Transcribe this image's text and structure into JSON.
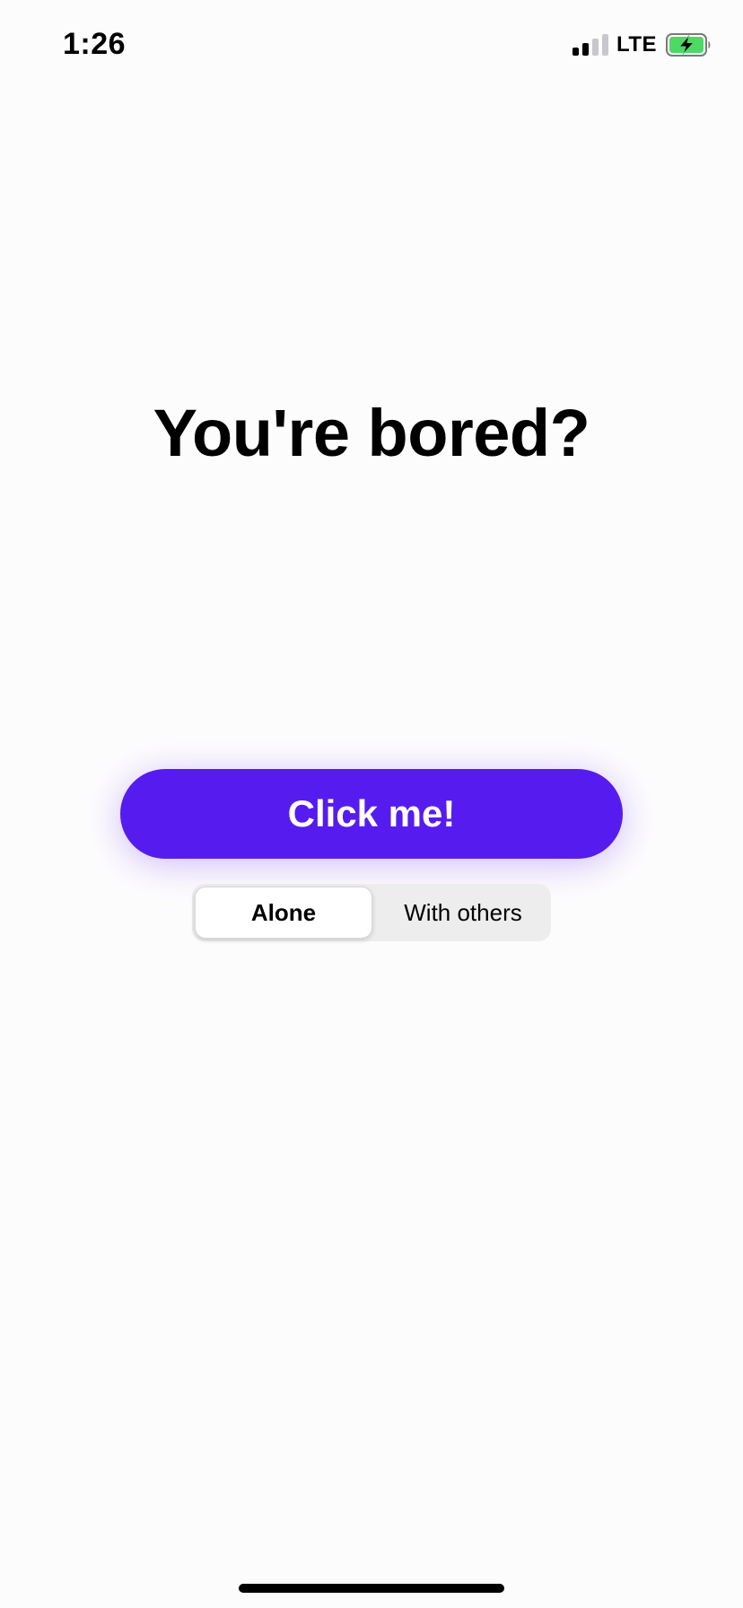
{
  "status_bar": {
    "time": "1:26",
    "network": "LTE",
    "signal_bars_filled": 2,
    "signal_bars_total": 4,
    "battery_state": "charging",
    "battery_color": "#4cd964"
  },
  "main": {
    "title": "You're bored?",
    "cta_label": "Click me!",
    "cta_color": "#561cef"
  },
  "mode_toggle": {
    "options": [
      "Alone",
      "With others"
    ],
    "selected": "Alone"
  }
}
